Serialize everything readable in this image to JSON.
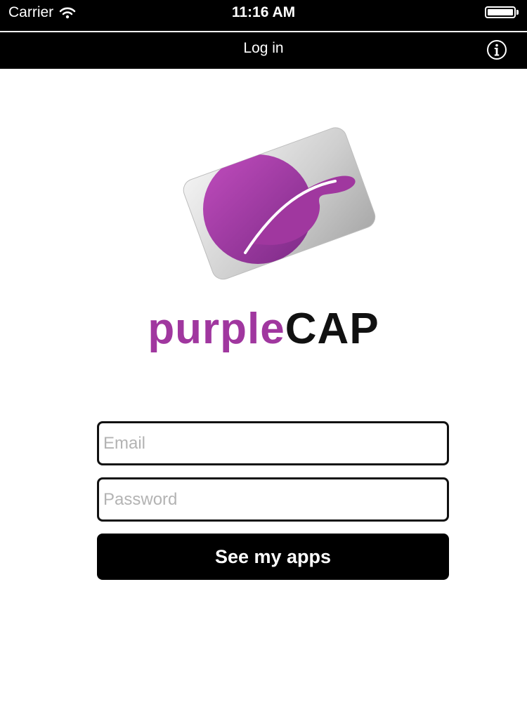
{
  "status_bar": {
    "carrier": "Carrier",
    "time": "11:16 AM",
    "wifi_icon": "wifi-icon",
    "battery_icon": "battery-icon",
    "battery_level": 1.0
  },
  "nav": {
    "title": "Log in",
    "info_icon": "info-icon"
  },
  "logo": {
    "brand_part1": "purple",
    "brand_part2": "CAP",
    "colors": {
      "purple": "#a0379f",
      "black": "#111111",
      "card_light": "#ececec",
      "card_dark": "#a9a9a9"
    }
  },
  "form": {
    "email_placeholder": "Email",
    "email_value": "",
    "password_placeholder": "Password",
    "password_value": "",
    "submit_label": "See my apps"
  }
}
